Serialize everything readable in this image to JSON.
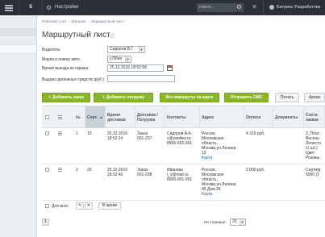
{
  "topbar": {
    "notifications": "5",
    "settings_label": "Настройки",
    "search_placeholder": "поиск...",
    "user_name": "Битрикс Разработчик"
  },
  "breadcrumb": [
    "Рабочий стол",
    "Магазин",
    "Маршрутный лист"
  ],
  "page_title": "Маршрутный лист",
  "form": {
    "driver_label": "Водитель:",
    "driver_value": "Сидоров В.Г.",
    "car_label": "Марка и номер авто:",
    "car_value": "у789иг",
    "departure_label": "Время выезда из гаража",
    "departure_value": "25.12.2016 18:52:58",
    "cash_label": "Выдано денежных средств (руб.)",
    "cash_value": ""
  },
  "toolbar": {
    "add_order": "Добавить заказ",
    "add_load": "Добавить погрузку",
    "all_routes": "Все маршруты на карте",
    "send_sms": "Отправить СМС",
    "print": "Печать",
    "archive": "Архив"
  },
  "table": {
    "headers": {
      "num": "№",
      "sort": "Сорт.",
      "time": "Время доставки",
      "delivery": "Доставка / Погрузка",
      "contacts": "Контакты",
      "address": "Адрес",
      "payment": "Оплата",
      "docs": "Документы",
      "composition": "Соста заказа"
    },
    "rows": [
      {
        "num": "1",
        "sort": "10",
        "date": "25.12.2016",
        "time": "18:52:14",
        "order": "Заказ",
        "order_id": "001-237",
        "contact_name": "Сидоров А.А.",
        "contact_email": "s@yandex.ru",
        "contact_phone": "8995-002-001",
        "addr1": "Россия,",
        "addr2": "Московская",
        "addr3": "область,",
        "addr4": "Москва,ул.Ленина",
        "addr5": "13",
        "map": "Карта",
        "payment": "4 319 руб.",
        "comp1": "3_Плат",
        "comp2": "Весенн",
        "comp3": "Лепесто",
        "comp4": "(1 шт.)",
        "comp5": "Цвет",
        "comp6": "Розовы"
      },
      {
        "num": "2",
        "sort": "20",
        "date": "25.12.2016",
        "time": "18:52:46",
        "order": "Заказ",
        "order_id": "001-238",
        "contact_name": "Иванова",
        "contact_email": "i_v@mail.ru",
        "contact_phone": "8995-001-001",
        "addr1": "Россия,",
        "addr2": "Московская",
        "addr3": "область,",
        "addr4": "Москва,ул.Ленина",
        "addr5": "45 Дом 35",
        "map": "Карта",
        "payment": "2 000 руб.",
        "comp1": "Сертиф",
        "comp2": "5000 (1"
      }
    ]
  },
  "footer": {
    "select_all": "Для всех",
    "to_archive": "В архив",
    "page": "1",
    "per_page_label": "На странице:",
    "per_page_value": "20"
  },
  "colors": {
    "accent_green": "#8bb629",
    "link_blue": "#2067b0",
    "topbar_bg": "#2b3038"
  }
}
